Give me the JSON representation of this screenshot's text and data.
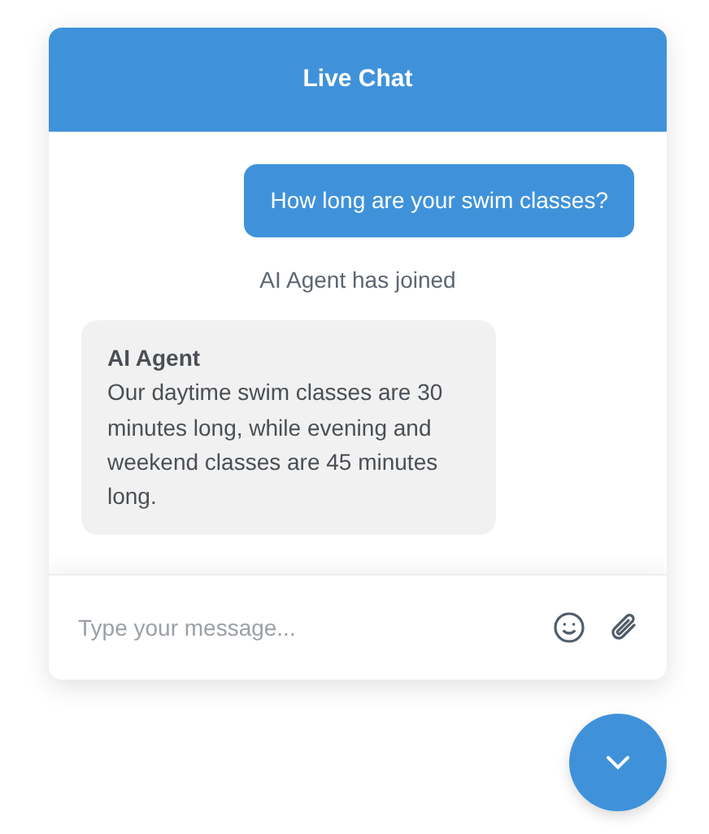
{
  "header": {
    "title": "Live Chat"
  },
  "messages": [
    {
      "kind": "user",
      "text": "How long are your swim classes?"
    },
    {
      "kind": "system",
      "text": "AI Agent has joined"
    },
    {
      "kind": "agent",
      "sender": "AI Agent",
      "text": "Our daytime swim classes are 30 minutes long, while evening and weekend classes are 45 minutes long."
    }
  ],
  "composer": {
    "placeholder": "Type your message..."
  }
}
